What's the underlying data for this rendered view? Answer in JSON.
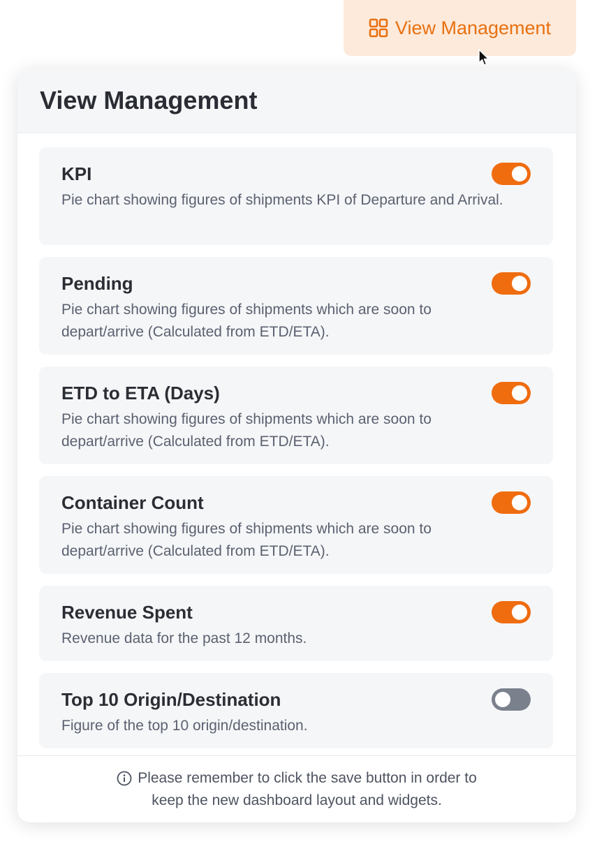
{
  "trigger": {
    "label": "View Management",
    "icon": "grid-icon",
    "accent": "#e8700f",
    "background": "#fdeadb"
  },
  "panel": {
    "title": "View Management",
    "cards": [
      {
        "title": "KPI",
        "description": "Pie chart showing figures of shipments KPI of Departure and Arrival.",
        "enabled": true
      },
      {
        "title": "Pending",
        "description": "Pie chart showing figures of shipments which are soon to depart/arrive (Calculated from ETD/ETA).",
        "enabled": true
      },
      {
        "title": "ETD to ETA (Days)",
        "description": "Pie chart showing figures of shipments which are soon to depart/arrive (Calculated from ETD/ETA).",
        "enabled": true
      },
      {
        "title": "Container Count",
        "description": "Pie chart showing figures of shipments which are soon to depart/arrive (Calculated from ETD/ETA).",
        "enabled": true
      },
      {
        "title": "Revenue Spent",
        "description": "Revenue data for the past 12 months.",
        "enabled": true
      },
      {
        "title": "Top 10 Origin/Destination",
        "description": "Figure of the top 10 origin/destination.",
        "enabled": false
      }
    ],
    "footer": {
      "icon": "info-icon",
      "line1": "Please remember to click the save button in order to",
      "line2": "keep the new dashboard layout and widgets."
    }
  },
  "colors": {
    "toggle_on": "#ef6c0f",
    "toggle_off": "#7a818d",
    "card_background": "#f5f6f8"
  }
}
